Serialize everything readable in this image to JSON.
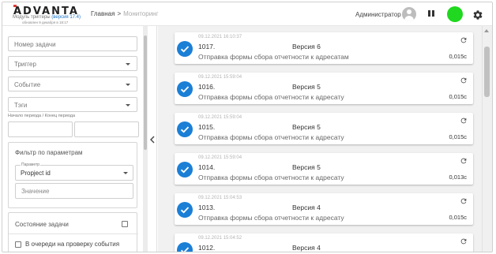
{
  "header": {
    "logo_main": "ADVANTA",
    "module_prefix": "Модуль триггеры ",
    "module_version": "(версия 17.4)",
    "updated": "обновлен 9 декабря в 18:17",
    "breadcrumb_home": "Главная",
    "breadcrumb_sep": ">",
    "breadcrumb_current": "Мониторинг",
    "user_name": "Администратор",
    "status_color": "#1fd81f"
  },
  "sidebar": {
    "task_number_placeholder": "Номер задачи",
    "trigger_placeholder": "Триггер",
    "event_placeholder": "Событие",
    "tags_placeholder": "Тэги",
    "period_label": "Начало периода / Конец периода",
    "param_filter_title": "Фильтр по параметрам",
    "param_select_label": "Параметр",
    "param_select_value": "Propject id",
    "param_value_placeholder": "Значение",
    "state_title": "Состояние задачи",
    "queue_label": "В очереди на проверку события"
  },
  "tasks": [
    {
      "time": "09.12.2021 16:10:37",
      "number": "1017.",
      "version": "Версия 6",
      "description": "Отправка формы сбора отчетности к адресатам",
      "duration": "0,015с"
    },
    {
      "time": "09.12.2021 15:59:04",
      "number": "1016.",
      "version": "Версия 5",
      "description": "Отправка формы сбора отчетности к адресату",
      "duration": "0,015с"
    },
    {
      "time": "09.12.2021 15:59:04",
      "number": "1015.",
      "version": "Версия 5",
      "description": "Отправка формы сбора отчетности к адресату",
      "duration": "0,015с"
    },
    {
      "time": "09.12.2021 15:59:04",
      "number": "1014.",
      "version": "Версия 5",
      "description": "Отправка формы сбора отчетности к адресату",
      "duration": "0,013с"
    },
    {
      "time": "09.12.2021 15:04:53",
      "number": "1013.",
      "version": "Версия 4",
      "description": "Отправка формы сбора отчетности к адресату",
      "duration": "0,015с"
    },
    {
      "time": "09.12.2021 15:04:52",
      "number": "1012.",
      "version": "Версия 4",
      "description": "",
      "duration": ""
    }
  ]
}
